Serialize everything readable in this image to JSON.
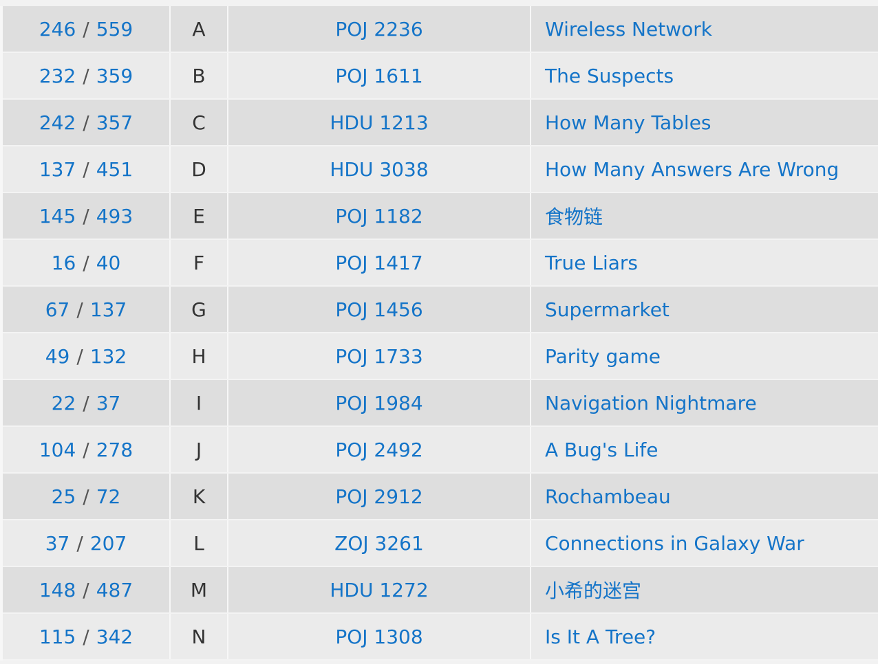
{
  "problems": [
    {
      "solved": "246",
      "attempted": "559",
      "letter": "A",
      "source": "POJ 2236",
      "title": "Wireless Network"
    },
    {
      "solved": "232",
      "attempted": "359",
      "letter": "B",
      "source": "POJ 1611",
      "title": "The Suspects"
    },
    {
      "solved": "242",
      "attempted": "357",
      "letter": "C",
      "source": "HDU 1213",
      "title": "How Many Tables"
    },
    {
      "solved": "137",
      "attempted": "451",
      "letter": "D",
      "source": "HDU 3038",
      "title": "How Many Answers Are Wrong"
    },
    {
      "solved": "145",
      "attempted": "493",
      "letter": "E",
      "source": "POJ 1182",
      "title": "食物链"
    },
    {
      "solved": "16",
      "attempted": "40",
      "letter": "F",
      "source": "POJ 1417",
      "title": "True Liars"
    },
    {
      "solved": "67",
      "attempted": "137",
      "letter": "G",
      "source": "POJ 1456",
      "title": "Supermarket"
    },
    {
      "solved": "49",
      "attempted": "132",
      "letter": "H",
      "source": "POJ 1733",
      "title": "Parity game"
    },
    {
      "solved": "22",
      "attempted": "37",
      "letter": "I",
      "source": "POJ 1984",
      "title": "Navigation Nightmare"
    },
    {
      "solved": "104",
      "attempted": "278",
      "letter": "J",
      "source": "POJ 2492",
      "title": "A Bug's Life"
    },
    {
      "solved": "25",
      "attempted": "72",
      "letter": "K",
      "source": "POJ 2912",
      "title": "Rochambeau"
    },
    {
      "solved": "37",
      "attempted": "207",
      "letter": "L",
      "source": "ZOJ 3261",
      "title": "Connections in Galaxy War"
    },
    {
      "solved": "148",
      "attempted": "487",
      "letter": "M",
      "source": "HDU 1272",
      "title": "小希的迷宫"
    },
    {
      "solved": "115",
      "attempted": "342",
      "letter": "N",
      "source": "POJ 1308",
      "title": "Is It A Tree?"
    }
  ],
  "separator": "/",
  "colors": {
    "link": "#1474c8",
    "row_odd": "#dedede",
    "row_even": "#ebebeb"
  }
}
